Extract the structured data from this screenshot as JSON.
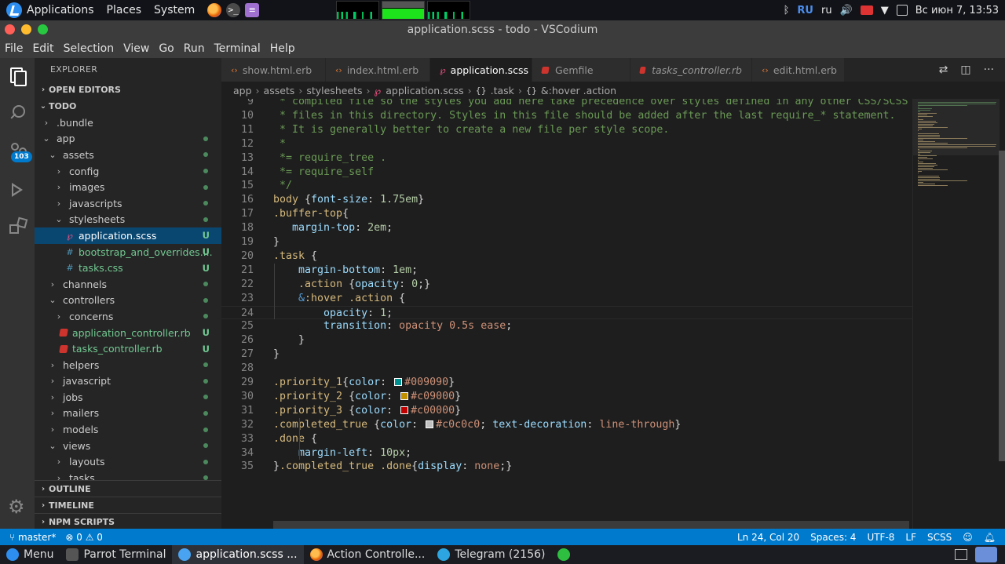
{
  "os_panel": {
    "menus": [
      "Applications",
      "Places",
      "System"
    ],
    "icons": [
      "vscodium-logo-icon",
      "firefox-icon",
      "terminal-icon",
      "text-editor-icon"
    ],
    "tray": {
      "layout_short": "RU",
      "layout_lang": "ru",
      "datetime": "Вс июн  7, 13:53"
    }
  },
  "window": {
    "title": "application.scss - todo - VSCodium"
  },
  "menubar": [
    "File",
    "Edit",
    "Selection",
    "View",
    "Go",
    "Run",
    "Terminal",
    "Help"
  ],
  "activity_bar": {
    "scm_badge": "103"
  },
  "sidebar": {
    "title": "EXPLORER",
    "open_editors": "OPEN EDITORS",
    "project": "TODO",
    "tree": [
      {
        "label": ".bundle",
        "depth": 1,
        "type": "folder",
        "open": false,
        "git": ""
      },
      {
        "label": "app",
        "depth": 1,
        "type": "folder",
        "open": true,
        "git": "dot"
      },
      {
        "label": "assets",
        "depth": 2,
        "type": "folder",
        "open": true,
        "git": "dot"
      },
      {
        "label": "config",
        "depth": 3,
        "type": "folder",
        "open": false,
        "git": "dot"
      },
      {
        "label": "images",
        "depth": 3,
        "type": "folder",
        "open": false,
        "git": "dot"
      },
      {
        "label": "javascripts",
        "depth": 3,
        "type": "folder",
        "open": false,
        "git": "dot"
      },
      {
        "label": "stylesheets",
        "depth": 3,
        "type": "folder",
        "open": true,
        "git": "dot"
      },
      {
        "label": "application.scss",
        "depth": 4,
        "type": "scss",
        "git": "U",
        "selected": true
      },
      {
        "label": "bootstrap_and_overrides....",
        "depth": 4,
        "type": "css",
        "git": "U"
      },
      {
        "label": "tasks.css",
        "depth": 4,
        "type": "css",
        "git": "U"
      },
      {
        "label": "channels",
        "depth": 2,
        "type": "folder",
        "open": false,
        "git": "dot"
      },
      {
        "label": "controllers",
        "depth": 2,
        "type": "folder",
        "open": true,
        "git": "dot"
      },
      {
        "label": "concerns",
        "depth": 3,
        "type": "folder",
        "open": false,
        "git": "dot"
      },
      {
        "label": "application_controller.rb",
        "depth": 3,
        "type": "rb",
        "git": "U"
      },
      {
        "label": "tasks_controller.rb",
        "depth": 3,
        "type": "rb",
        "git": "U"
      },
      {
        "label": "helpers",
        "depth": 2,
        "type": "folder",
        "open": false,
        "git": "dot"
      },
      {
        "label": "javascript",
        "depth": 2,
        "type": "folder",
        "open": false,
        "git": "dot"
      },
      {
        "label": "jobs",
        "depth": 2,
        "type": "folder",
        "open": false,
        "git": "dot"
      },
      {
        "label": "mailers",
        "depth": 2,
        "type": "folder",
        "open": false,
        "git": "dot"
      },
      {
        "label": "models",
        "depth": 2,
        "type": "folder",
        "open": false,
        "git": "dot"
      },
      {
        "label": "views",
        "depth": 2,
        "type": "folder",
        "open": true,
        "git": "dot"
      },
      {
        "label": "layouts",
        "depth": 3,
        "type": "folder",
        "open": false,
        "git": "dot"
      },
      {
        "label": "tasks",
        "depth": 3,
        "type": "folder",
        "open": false,
        "git": "dot"
      }
    ],
    "bottom_sections": [
      "OUTLINE",
      "TIMELINE",
      "NPM SCRIPTS"
    ]
  },
  "tabs": [
    {
      "label": "show.html.erb",
      "icon": "html",
      "active": false,
      "italic": false
    },
    {
      "label": "index.html.erb",
      "icon": "html",
      "active": false,
      "italic": false
    },
    {
      "label": "application.scss",
      "icon": "scss",
      "active": true,
      "italic": false
    },
    {
      "label": "Gemfile",
      "icon": "rb",
      "active": false,
      "italic": false
    },
    {
      "label": "tasks_controller.rb",
      "icon": "rb",
      "active": false,
      "italic": true
    },
    {
      "label": "edit.html.erb",
      "icon": "html",
      "active": false,
      "italic": false
    }
  ],
  "breadcrumb": [
    "app",
    "assets",
    "stylesheets",
    "application.scss",
    ".task",
    "&:hover .action"
  ],
  "editor": {
    "current_line": 24,
    "lines": [
      {
        "n": 9,
        "tokens": [
          {
            "t": " * compiled file so the styles you add here take precedence over styles defined in any other CSS/SCSS",
            "c": "com"
          }
        ]
      },
      {
        "n": 10,
        "tokens": [
          {
            "t": " * files in this directory. Styles in this file should be added after the last require_* statement.",
            "c": "com"
          }
        ]
      },
      {
        "n": 11,
        "tokens": [
          {
            "t": " * It is generally better to create a new file per style scope.",
            "c": "com"
          }
        ]
      },
      {
        "n": 12,
        "tokens": [
          {
            "t": " *",
            "c": "com"
          }
        ]
      },
      {
        "n": 13,
        "tokens": [
          {
            "t": " *= require_tree .",
            "c": "com"
          }
        ]
      },
      {
        "n": 14,
        "tokens": [
          {
            "t": " *= require_self",
            "c": "com"
          }
        ]
      },
      {
        "n": 15,
        "tokens": [
          {
            "t": " */",
            "c": "com"
          }
        ]
      },
      {
        "n": 16,
        "tokens": [
          {
            "t": "body",
            "c": "tag"
          },
          {
            "t": " {",
            "c": "pun"
          },
          {
            "t": "font-size",
            "c": "prop"
          },
          {
            "t": ": ",
            "c": "pun"
          },
          {
            "t": "1.75em",
            "c": "num"
          },
          {
            "t": "}",
            "c": "pun"
          }
        ]
      },
      {
        "n": 17,
        "tokens": [
          {
            "t": ".buffer-top",
            "c": "tag"
          },
          {
            "t": "{",
            "c": "pun"
          }
        ]
      },
      {
        "n": 18,
        "tokens": [
          {
            "t": "   ",
            "c": "pun"
          },
          {
            "t": "margin-top",
            "c": "prop"
          },
          {
            "t": ": ",
            "c": "pun"
          },
          {
            "t": "2em",
            "c": "num"
          },
          {
            "t": ";",
            "c": "pun"
          }
        ]
      },
      {
        "n": 19,
        "tokens": [
          {
            "t": "}",
            "c": "pun"
          }
        ]
      },
      {
        "n": 20,
        "tokens": [
          {
            "t": ".task",
            "c": "tag"
          },
          {
            "t": " {",
            "c": "pun"
          }
        ]
      },
      {
        "n": 21,
        "tokens": [
          {
            "t": "    ",
            "c": "pun"
          },
          {
            "t": "margin-bottom",
            "c": "prop"
          },
          {
            "t": ": ",
            "c": "pun"
          },
          {
            "t": "1em",
            "c": "num"
          },
          {
            "t": ";",
            "c": "pun"
          }
        ]
      },
      {
        "n": 22,
        "tokens": [
          {
            "t": "    ",
            "c": "pun"
          },
          {
            "t": ".action",
            "c": "tag"
          },
          {
            "t": " {",
            "c": "pun"
          },
          {
            "t": "opacity",
            "c": "prop"
          },
          {
            "t": ": ",
            "c": "pun"
          },
          {
            "t": "0",
            "c": "num"
          },
          {
            "t": ";}",
            "c": "pun"
          }
        ]
      },
      {
        "n": 23,
        "tokens": [
          {
            "t": "    ",
            "c": "pun"
          },
          {
            "t": "&",
            "c": "amp"
          },
          {
            "t": ":hover .action",
            "c": "tag"
          },
          {
            "t": " {",
            "c": "pun"
          }
        ]
      },
      {
        "n": 24,
        "tokens": [
          {
            "t": "        ",
            "c": "pun"
          },
          {
            "t": "opacity",
            "c": "prop"
          },
          {
            "t": ": ",
            "c": "pun"
          },
          {
            "t": "1",
            "c": "num"
          },
          {
            "t": ";",
            "c": "pun"
          }
        ]
      },
      {
        "n": 25,
        "tokens": [
          {
            "t": "        ",
            "c": "pun"
          },
          {
            "t": "transition",
            "c": "prop"
          },
          {
            "t": ": ",
            "c": "pun"
          },
          {
            "t": "opacity 0.5s ease",
            "c": "val"
          },
          {
            "t": ";",
            "c": "pun"
          }
        ]
      },
      {
        "n": 26,
        "tokens": [
          {
            "t": "    }",
            "c": "pun"
          }
        ]
      },
      {
        "n": 27,
        "tokens": [
          {
            "t": "}",
            "c": "pun"
          }
        ]
      },
      {
        "n": 28,
        "tokens": []
      },
      {
        "n": 29,
        "tokens": [
          {
            "t": ".priority_1",
            "c": "tag"
          },
          {
            "t": "{",
            "c": "pun"
          },
          {
            "t": "color",
            "c": "prop"
          },
          {
            "t": ": ",
            "c": "pun"
          },
          {
            "t": "#009090",
            "c": "val",
            "swatch": "#009090"
          },
          {
            "t": "}",
            "c": "pun"
          }
        ]
      },
      {
        "n": 30,
        "tokens": [
          {
            "t": ".priority_2",
            "c": "tag"
          },
          {
            "t": " {",
            "c": "pun"
          },
          {
            "t": "color",
            "c": "prop"
          },
          {
            "t": ": ",
            "c": "pun"
          },
          {
            "t": "#c09000",
            "c": "val",
            "swatch": "#c09000"
          },
          {
            "t": "}",
            "c": "pun"
          }
        ]
      },
      {
        "n": 31,
        "tokens": [
          {
            "t": ".priority_3",
            "c": "tag"
          },
          {
            "t": " {",
            "c": "pun"
          },
          {
            "t": "color",
            "c": "prop"
          },
          {
            "t": ": ",
            "c": "pun"
          },
          {
            "t": "#c00000",
            "c": "val",
            "swatch": "#c00000"
          },
          {
            "t": "}",
            "c": "pun"
          }
        ]
      },
      {
        "n": 32,
        "tokens": [
          {
            "t": ".completed_true",
            "c": "tag"
          },
          {
            "t": " {",
            "c": "pun"
          },
          {
            "t": "color",
            "c": "prop"
          },
          {
            "t": ": ",
            "c": "pun"
          },
          {
            "t": "#c0c0c0",
            "c": "val",
            "swatch": "#c0c0c0"
          },
          {
            "t": "; ",
            "c": "pun"
          },
          {
            "t": "text-decoration",
            "c": "prop"
          },
          {
            "t": ": ",
            "c": "pun"
          },
          {
            "t": "line-through",
            "c": "val"
          },
          {
            "t": "}",
            "c": "pun"
          }
        ]
      },
      {
        "n": 33,
        "tokens": [
          {
            "t": ".done",
            "c": "tag"
          },
          {
            "t": " {",
            "c": "pun"
          }
        ]
      },
      {
        "n": 34,
        "tokens": [
          {
            "t": "    ",
            "c": "pun"
          },
          {
            "t": "margin-left",
            "c": "prop"
          },
          {
            "t": ": ",
            "c": "pun"
          },
          {
            "t": "10px",
            "c": "num"
          },
          {
            "t": ";",
            "c": "pun"
          }
        ]
      },
      {
        "n": 35,
        "tokens": [
          {
            "t": "}",
            "c": "pun"
          },
          {
            "t": ".completed_true .done",
            "c": "tag"
          },
          {
            "t": "{",
            "c": "pun"
          },
          {
            "t": "display",
            "c": "prop"
          },
          {
            "t": ": ",
            "c": "pun"
          },
          {
            "t": "none",
            "c": "val"
          },
          {
            "t": ";}",
            "c": "pun"
          }
        ]
      }
    ]
  },
  "statusbar": {
    "branch": "master*",
    "problems": "0",
    "warnings": "0",
    "position": "Ln 24, Col 20",
    "spaces": "Spaces: 4",
    "encoding": "UTF-8",
    "eol": "LF",
    "language": "SCSS"
  },
  "taskbar": {
    "menu": "Menu",
    "items": [
      {
        "label": "Parrot Terminal",
        "icon": "terminal-icon",
        "active": false
      },
      {
        "label": "application.scss ...",
        "icon": "vscodium-icon",
        "active": true
      },
      {
        "label": "Action Controlle...",
        "icon": "firefox-icon",
        "active": false
      },
      {
        "label": "Telegram (2156)",
        "icon": "telegram-icon",
        "active": false
      }
    ]
  },
  "colors": {
    "accent": "#007acc",
    "selection": "#094771",
    "git_untracked": "#73c991"
  }
}
